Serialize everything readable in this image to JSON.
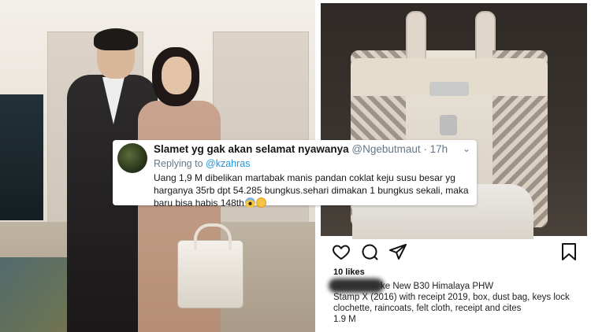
{
  "tweet": {
    "display_name": "Slamet yg gak akan selamat nyawanya",
    "handle": "@Ngebutmaut",
    "time": "· 17h",
    "reply_prefix": "Replying to",
    "reply_to": "@kzahras",
    "text": "Uang 1,9 M dibelikan martabak manis pandan coklat keju susu besar yg harganya 35rb dpt 54.285 bungkus.sehari dimakan 1 bungkus sekali, maka baru bisa habis 148th",
    "emojis": [
      "scream-emoji",
      "flushed-emoji"
    ],
    "menu_icon": "chevron-down-icon"
  },
  "instagram": {
    "icons": [
      "heart-icon",
      "comment-icon",
      "share-icon",
      "bookmark-icon"
    ],
    "likes": "10 likes",
    "caption_line1": "ke New B30 Himalaya PHW",
    "caption_line2": "Stamp X (2016) with receipt 2019, box, dust bag, keys lock clochette, raincoats, felt cloth, receipt and cites",
    "caption_price": "1.9 M"
  },
  "colors": {
    "twitter_link": "#1b95e0",
    "twitter_gray": "#657786",
    "text_dark": "#14171a"
  }
}
